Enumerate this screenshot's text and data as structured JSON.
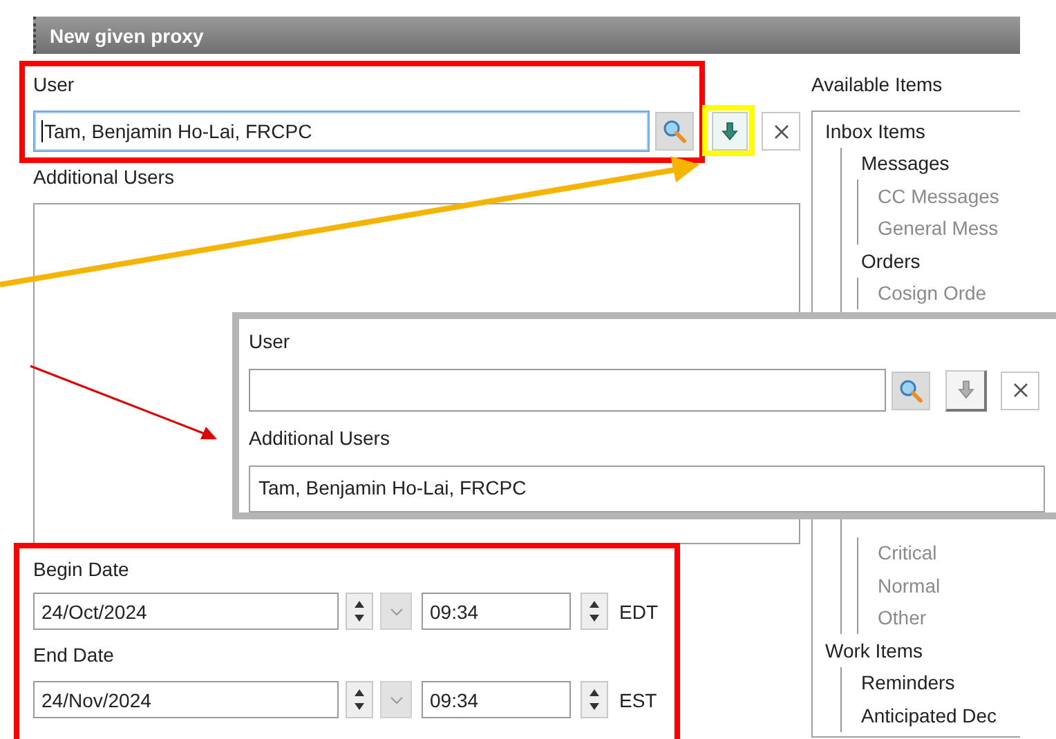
{
  "panel": {
    "title": "New given proxy"
  },
  "user": {
    "label": "User",
    "value": "Tam, Benjamin Ho-Lai, FRCPC",
    "focused": true,
    "add_button": {
      "disabled": false
    }
  },
  "additional_users": {
    "label": "Additional Users"
  },
  "begin_date": {
    "label": "Begin Date",
    "date": "24/Oct/2024",
    "time": "09:34",
    "zone": "EDT"
  },
  "end_date": {
    "label": "End Date",
    "date": "24/Nov/2024",
    "time": "09:34",
    "zone": "EST"
  },
  "available_items": {
    "label": "Available Items",
    "tree": [
      {
        "label": "Inbox Items",
        "children": [
          {
            "label": "Messages",
            "children": [
              {
                "label": "CC Messages"
              },
              {
                "label": "General Mess"
              }
            ]
          },
          {
            "label": "Orders",
            "children": [
              {
                "label": "Cosign Orde"
              }
            ]
          },
          {
            "kind": "covered",
            "children": [
              {
                "label": "Critical"
              },
              {
                "label": "Normal"
              },
              {
                "label": "Other"
              }
            ]
          }
        ]
      },
      {
        "label": "Work Items",
        "children": [
          {
            "label": "Reminders"
          },
          {
            "label": "Anticipated Dec"
          }
        ]
      }
    ]
  },
  "inset": {
    "user": {
      "label": "User",
      "focused": false,
      "add_button": {
        "disabled": true
      }
    },
    "additional_users": {
      "label": "Additional Users",
      "items": [
        "Tam, Benjamin Ho-Lai, FRCPC"
      ]
    }
  }
}
